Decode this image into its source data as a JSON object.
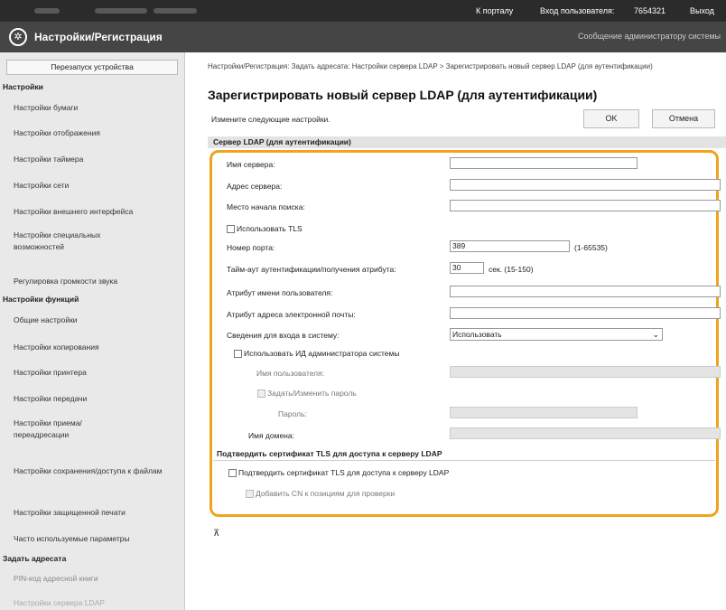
{
  "topbar": {
    "portal_link": "К порталу",
    "login_user_label": "Вход пользователя:",
    "login_user_value": "7654321",
    "logout_link": "Выход"
  },
  "header": {
    "title": "Настройки/Регистрация",
    "admin_message_link": "Сообщение администратору системы"
  },
  "sidebar": {
    "restart_button": "Перезапуск устройства",
    "section_settings": "Настройки",
    "items_settings": [
      "Настройки бумаги",
      "Настройки отображения",
      "Настройки таймера",
      "Настройки сети",
      "Настройки внешнего интерфейса",
      "Настройки специальных возможностей",
      "Регулировка громкости звука"
    ],
    "section_functions": "Настройки функций",
    "items_functions": [
      "Общие настройки",
      "Настройки копирования",
      "Настройки принтера",
      "Настройки передачи",
      "Настройки приема/переадресации",
      "Настройки сохранения/доступа к файлам",
      "Настройки защищенной печати",
      "Часто используемые параметры"
    ],
    "section_address": "Задать адресата",
    "items_address": [
      "PIN-код адресной книги",
      "Настройки сервера LDAP"
    ]
  },
  "main": {
    "breadcrumb": "Настройки/Регистрация: Задать адресата: Настройки сервера LDAP > Зарегистрировать новый сервер LDAP (для аутентификации)",
    "page_title": "Зарегистрировать новый сервер LDAP (для аутентификации)",
    "instruction": "Измените следующие настройки.",
    "ok_button": "OK",
    "cancel_button": "Отмена",
    "section_title": "Сервер LDAP (для аутентификации)",
    "fields": {
      "server_name_label": "Имя сервера:",
      "server_name_value": "",
      "server_address_label": "Адрес сервера:",
      "server_address_value": "",
      "search_start_label": "Место начала поиска:",
      "search_start_value": "",
      "use_tls_label": "Использовать TLS",
      "port_label": "Номер порта:",
      "port_value": "389",
      "port_range": "(1-65535)",
      "timeout_label": "Тайм-аут аутентификации/получения атрибута:",
      "timeout_value": "30",
      "timeout_unit": "сек. (15-150)",
      "username_attr_label": "Атрибут имени пользователя:",
      "username_attr_value": "",
      "email_attr_label": "Атрибут адреса электронной почты:",
      "email_attr_value": "",
      "login_info_label": "Сведения для входа в систему:",
      "login_info_value": "Использовать",
      "use_admin_id_label": "Использовать ИД администратора системы",
      "user_name_label": "Имя пользователя:",
      "set_password_label": "Задать/Изменить пароль",
      "password_label": "Пароль:",
      "domain_label": "Имя домена:"
    },
    "tls_section_title": "Подтвердить сертификат TLS для доступа к серверу LDAP",
    "tls_verify_label": "Подтвердить сертификат TLS для доступа к серверу LDAP",
    "add_cn_label": "Добавить CN к позициям для проверки",
    "top_icon": "⊼"
  }
}
